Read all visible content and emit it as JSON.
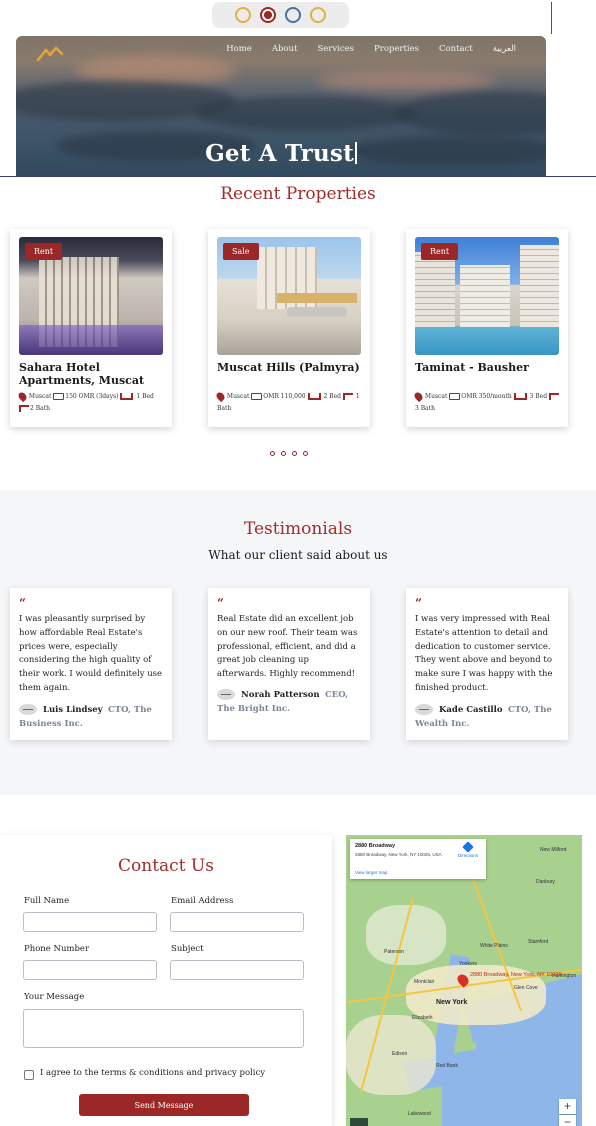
{
  "theme": {
    "accent": "#9b2727",
    "swatches": [
      "gold",
      "crimson",
      "blue",
      "gold"
    ]
  },
  "nav": {
    "logo": "logo-icon",
    "links": [
      "Home",
      "About",
      "Services",
      "Properties",
      "Contact",
      "العربية"
    ]
  },
  "hero": {
    "title": "Get A Trust"
  },
  "recent": {
    "title": "Recent Properties",
    "cards": [
      {
        "badge": "Rent",
        "title": "Sahara Hotel Apartments, Muscat",
        "location": "Muscat",
        "price": "150 OMR (3days)",
        "beds": "1 Bed",
        "baths": "2 Bath"
      },
      {
        "badge": "Sale",
        "title": "Muscat Hills (Palmyra)",
        "location": "Muscat",
        "price": "OMR 110,000",
        "beds": "2 Bed",
        "baths": "1 Bath"
      },
      {
        "badge": "Rent",
        "title": "Taminat - Bausher",
        "location": "Muscat",
        "price": "OMR 350/month",
        "beds": "3 Bed",
        "baths": "3 Bath"
      }
    ]
  },
  "testimonials": {
    "title": "Testimonials",
    "subtitle": "What our client said about us",
    "items": [
      {
        "text": "I was pleasantly surprised by how affordable Real Estate's prices were, especially considering the high quality of their work. I would definitely use them again.",
        "name": "Luis Lindsey",
        "role": "CTO, The Business Inc."
      },
      {
        "text": "Real Estate did an excellent job on our new roof. Their team was professional, efficient, and did a great job cleaning up afterwards. Highly recommend!",
        "name": "Norah Patterson",
        "role": "CEO, The Bright Inc."
      },
      {
        "text": "I was very impressed with Real Estate's attention to detail and dedication to customer service. They went above and beyond to make sure I was happy with the finished product.",
        "name": "Kade Castillo",
        "role": "CTO, The Wealth Inc."
      }
    ]
  },
  "contact": {
    "title": "Contact Us",
    "full_name": "Full Name",
    "email": "Email Address",
    "phone": "Phone Number",
    "subject": "Subject",
    "message": "Your Message",
    "agree": "I agree to the terms & conditions and privacy policy",
    "send": "Send Message"
  },
  "map": {
    "place": "2880 Broadway",
    "address": "2880 Broadway, New York, NY 10025, USA",
    "directions": "Directions",
    "larger": "View larger map",
    "marker": "2880 Broadway, New York, NY 10025",
    "labels": {
      "new_york": "New York",
      "yonkers": "Yonkers",
      "new_milford": "New Milford",
      "danbury": "Danbury",
      "stamford": "Stamford",
      "huntington": "Huntington",
      "montclair": "Montclair",
      "elizabeth": "Elizabeth",
      "edison": "Edison",
      "red_bank": "Red Bank",
      "lakewood": "Lakewood",
      "paterson": "Paterson",
      "white_plains": "White Plains",
      "glen_cove": "Glen Cove"
    }
  }
}
